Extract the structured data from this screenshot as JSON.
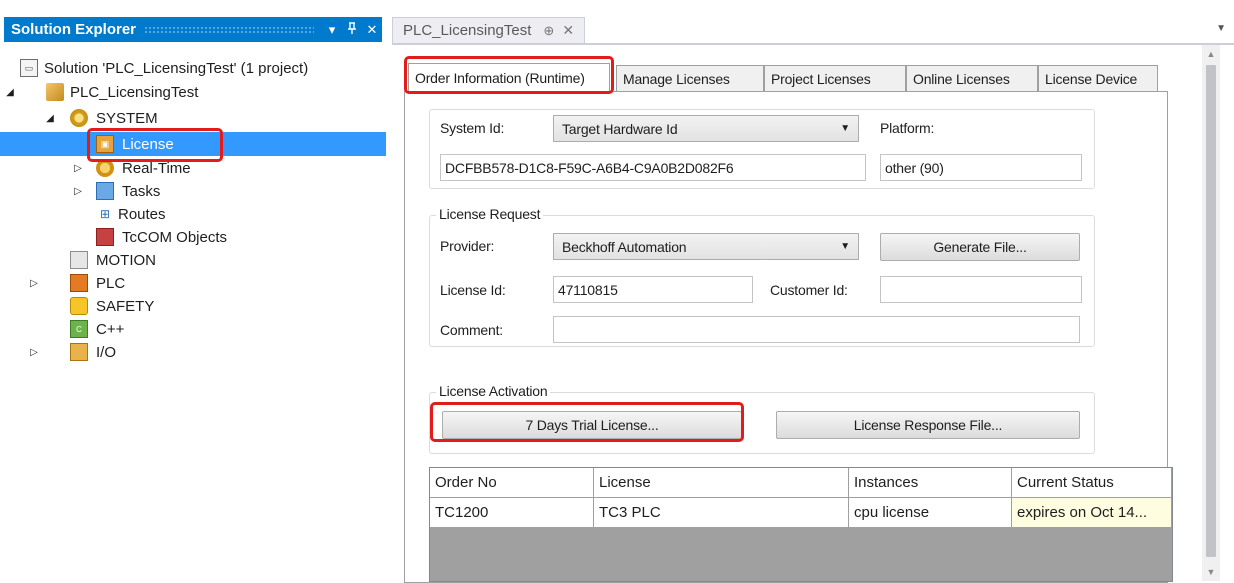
{
  "solution_explorer": {
    "title": "Solution Explorer",
    "dropdown_icon": "▾",
    "pin_icon": "ᵖ",
    "close_icon": "✕",
    "tree": [
      {
        "label": "Solution 'PLC_LicensingTest' (1 project)",
        "icon": "solution-icon"
      },
      {
        "label": "PLC_LicensingTest",
        "icon": "project-icon"
      },
      {
        "label": "SYSTEM",
        "icon": "system-gear-icon"
      },
      {
        "label": "License",
        "icon": "license-icon"
      },
      {
        "label": "Real-Time",
        "icon": "realtime-icon"
      },
      {
        "label": "Tasks",
        "icon": "tasks-icon"
      },
      {
        "label": "Routes",
        "icon": "routes-icon"
      },
      {
        "label": "TcCOM Objects",
        "icon": "tccom-icon"
      },
      {
        "label": "MOTION",
        "icon": "motion-icon"
      },
      {
        "label": "PLC",
        "icon": "plc-icon"
      },
      {
        "label": "SAFETY",
        "icon": "safety-icon"
      },
      {
        "label": "C++",
        "icon": "cpp-icon"
      },
      {
        "label": "I/O",
        "icon": "io-icon"
      }
    ],
    "selected": "License"
  },
  "document_tab": {
    "label": "PLC_LicensingTest",
    "pin_icon": "⊕",
    "close_icon": "✕"
  },
  "inner_tabs": [
    {
      "label": "Order Information (Runtime)",
      "active": true
    },
    {
      "label": "Manage Licenses",
      "active": false
    },
    {
      "label": "Project Licenses",
      "active": false
    },
    {
      "label": "Online Licenses",
      "active": false
    },
    {
      "label": "License Device",
      "active": false
    }
  ],
  "system": {
    "system_id_label": "System Id:",
    "system_id_select": "Target Hardware Id",
    "system_id_value": "DCFBB578-D1C8-F59C-A6B4-C9A0B2D082F6",
    "platform_label": "Platform:",
    "platform_value": "other (90)"
  },
  "license_request": {
    "title": "License Request",
    "provider_label": "Provider:",
    "provider_select": "Beckhoff Automation",
    "generate_button": "Generate File...",
    "license_id_label": "License Id:",
    "license_id_value": "47110815",
    "customer_id_label": "Customer Id:",
    "customer_id_value": "",
    "comment_label": "Comment:",
    "comment_value": ""
  },
  "license_activation": {
    "title": "License Activation",
    "trial_button": "7 Days Trial License...",
    "response_button": "License Response File..."
  },
  "grid": {
    "columns": [
      "Order No",
      "License",
      "Instances",
      "Current Status"
    ],
    "rows": [
      [
        "TC1200",
        "TC3 PLC",
        "cpu license",
        "expires on Oct 14..."
      ]
    ]
  },
  "colors": {
    "accent": "#007acc",
    "selection": "#3399ff",
    "highlight_box": "#e21b1b"
  }
}
